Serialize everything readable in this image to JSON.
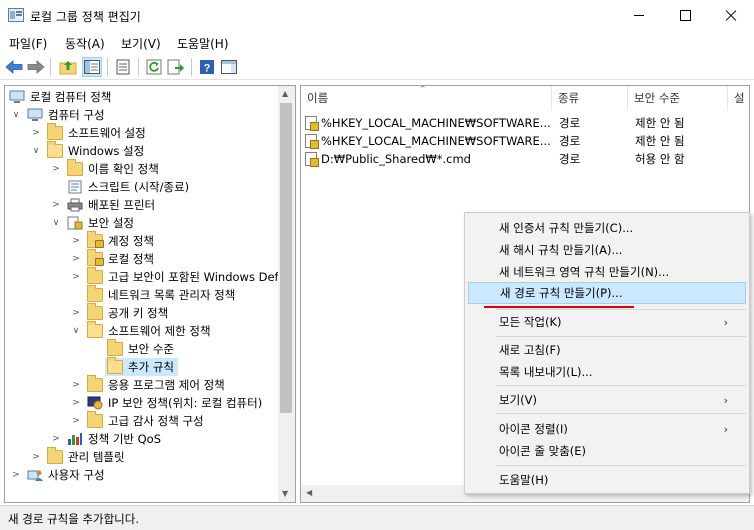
{
  "window": {
    "title": "로컬 그룹 정책 편집기",
    "accent": "#0078d7"
  },
  "menu": {
    "file": "파일(F)",
    "action": "동작(A)",
    "view": "보기(V)",
    "help": "도움말(H)"
  },
  "toolbar": {
    "icons": [
      "back-icon",
      "forward-icon",
      "up-folder-icon",
      "show-hide-tree-icon",
      "properties-icon",
      "refresh-icon",
      "export-list-icon",
      "help-icon",
      "show-action-pane-icon"
    ]
  },
  "tree": {
    "items": [
      {
        "label": "로컬 컴퓨터 정책",
        "icon": "computer-policy-icon"
      },
      {
        "label": "컴퓨터 구성",
        "icon": "computer-icon"
      },
      {
        "label": "소프트웨어 설정",
        "icon": "folder-icon"
      },
      {
        "label": "Windows 설정",
        "icon": "folder-icon"
      },
      {
        "label": "이름 확인 정책",
        "icon": "folder-icon"
      },
      {
        "label": "스크립트 (시작/종료)",
        "icon": "script-icon"
      },
      {
        "label": "배포된 프린터",
        "icon": "printer-icon"
      },
      {
        "label": "보안 설정",
        "icon": "security-icon"
      },
      {
        "label": "계정 정책",
        "icon": "locked-folder-icon"
      },
      {
        "label": "로컬 정책",
        "icon": "locked-folder-icon"
      },
      {
        "label": "고급 보안이 포함된 Windows Defender 방화벽",
        "icon": "folder-icon"
      },
      {
        "label": "네트워크 목록 관리자 정책",
        "icon": "folder-icon"
      },
      {
        "label": "공개 키 정책",
        "icon": "folder-icon"
      },
      {
        "label": "소프트웨어 제한 정책",
        "icon": "folder-icon"
      },
      {
        "label": "보안 수준",
        "icon": "folder-icon"
      },
      {
        "label": "추가 규칙",
        "icon": "folder-icon"
      },
      {
        "label": "응용 프로그램 제어 정책",
        "icon": "folder-icon"
      },
      {
        "label": "IP 보안 정책(위치: 로컬 컴퓨터)",
        "icon": "ip-security-icon"
      },
      {
        "label": "고급 감사 정책 구성",
        "icon": "folder-icon"
      },
      {
        "label": "정책 기반 QoS",
        "icon": "chart-icon"
      },
      {
        "label": "관리 템플릿",
        "icon": "folder-icon"
      },
      {
        "label": "사용자 구성",
        "icon": "user-icon"
      }
    ]
  },
  "list": {
    "columns": [
      "이름",
      "종류",
      "보안 수준",
      "설"
    ],
    "rows": [
      {
        "name": "%HKEY_LOCAL_MACHINE₩SOFTWARE...",
        "type": "경로",
        "level": "제한 안 됨"
      },
      {
        "name": "%HKEY_LOCAL_MACHINE₩SOFTWARE...",
        "type": "경로",
        "level": "제한 안 됨"
      },
      {
        "name": "D:₩Public_Shared₩*.cmd",
        "type": "경로",
        "level": "허용 안 함"
      }
    ]
  },
  "context_menu": {
    "new_certificate_rule": "새 인증서 규칙 만들기(C)...",
    "new_hash_rule": "새 해시 규칙 만들기(A)...",
    "new_network_zone_rule": "새 네트워크 영역 규칙 만들기(N)...",
    "new_path_rule": "새 경로 규칙 만들기(P)...",
    "all_tasks": "모든 작업(K)",
    "refresh": "새로 고침(F)",
    "export_list": "목록 내보내기(L)...",
    "view": "보기(V)",
    "arrange_icons": "아이콘 정렬(I)",
    "line_up_icons": "아이콘 줄 맞춤(E)",
    "help": "도움말(H)"
  },
  "status": {
    "text": "새 경로 규칙을 추가합니다."
  }
}
